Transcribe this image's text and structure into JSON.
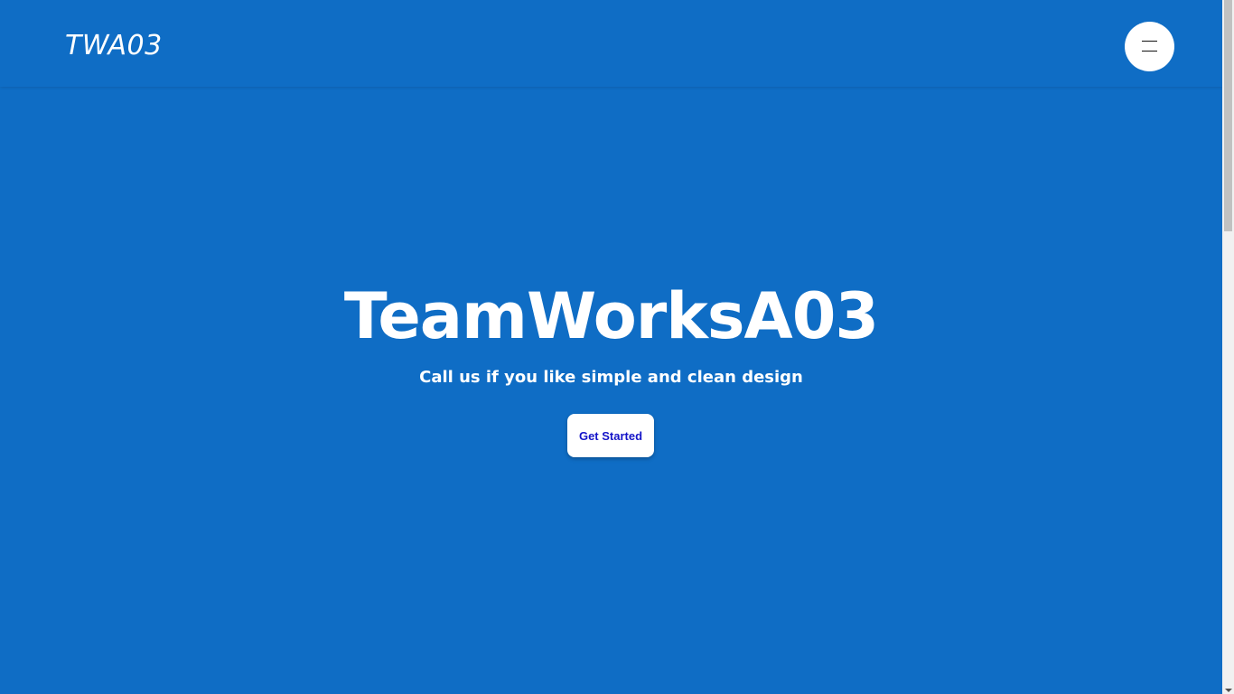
{
  "header": {
    "logo_text": "TWA03",
    "menu_icon": "hamburger-menu-icon"
  },
  "hero": {
    "title": "TeamWorksA03",
    "subtitle": "Call us if you like simple and clean design",
    "cta_label": "Get Started"
  },
  "colors": {
    "background": "#0f6dc5",
    "button_bg": "#ffffff",
    "button_text": "#1414c8"
  }
}
